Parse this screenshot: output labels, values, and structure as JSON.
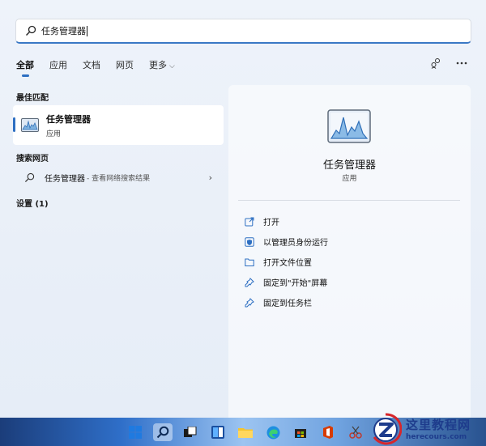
{
  "search": {
    "query": "任务管理器"
  },
  "tabs": [
    {
      "label": "全部"
    },
    {
      "label": "应用"
    },
    {
      "label": "文档"
    },
    {
      "label": "网页"
    },
    {
      "label": "更多"
    }
  ],
  "sections": {
    "best_match": "最佳匹配",
    "web_search": "搜索网页",
    "settings": "设置 (1)"
  },
  "best_match": {
    "name": "任务管理器",
    "type": "应用"
  },
  "web_result": {
    "title": "任务管理器",
    "suffix": "- 查看网络搜索结果"
  },
  "preview": {
    "title": "任务管理器",
    "type": "应用",
    "actions": [
      {
        "label": "打开",
        "icon": "open-external-icon"
      },
      {
        "label": "以管理员身份运行",
        "icon": "shield-icon"
      },
      {
        "label": "打开文件位置",
        "icon": "folder-icon"
      },
      {
        "label": "固定到\"开始\"屏幕",
        "icon": "pin-icon"
      },
      {
        "label": "固定到任务栏",
        "icon": "pin-icon"
      }
    ]
  },
  "watermark": {
    "title": "这里教程网",
    "url": "herecours.com"
  },
  "colors": {
    "accent": "#2d6fc2",
    "taskbar_start": "#1b3d7a",
    "taskbar_mid": "#9cc4f1"
  }
}
